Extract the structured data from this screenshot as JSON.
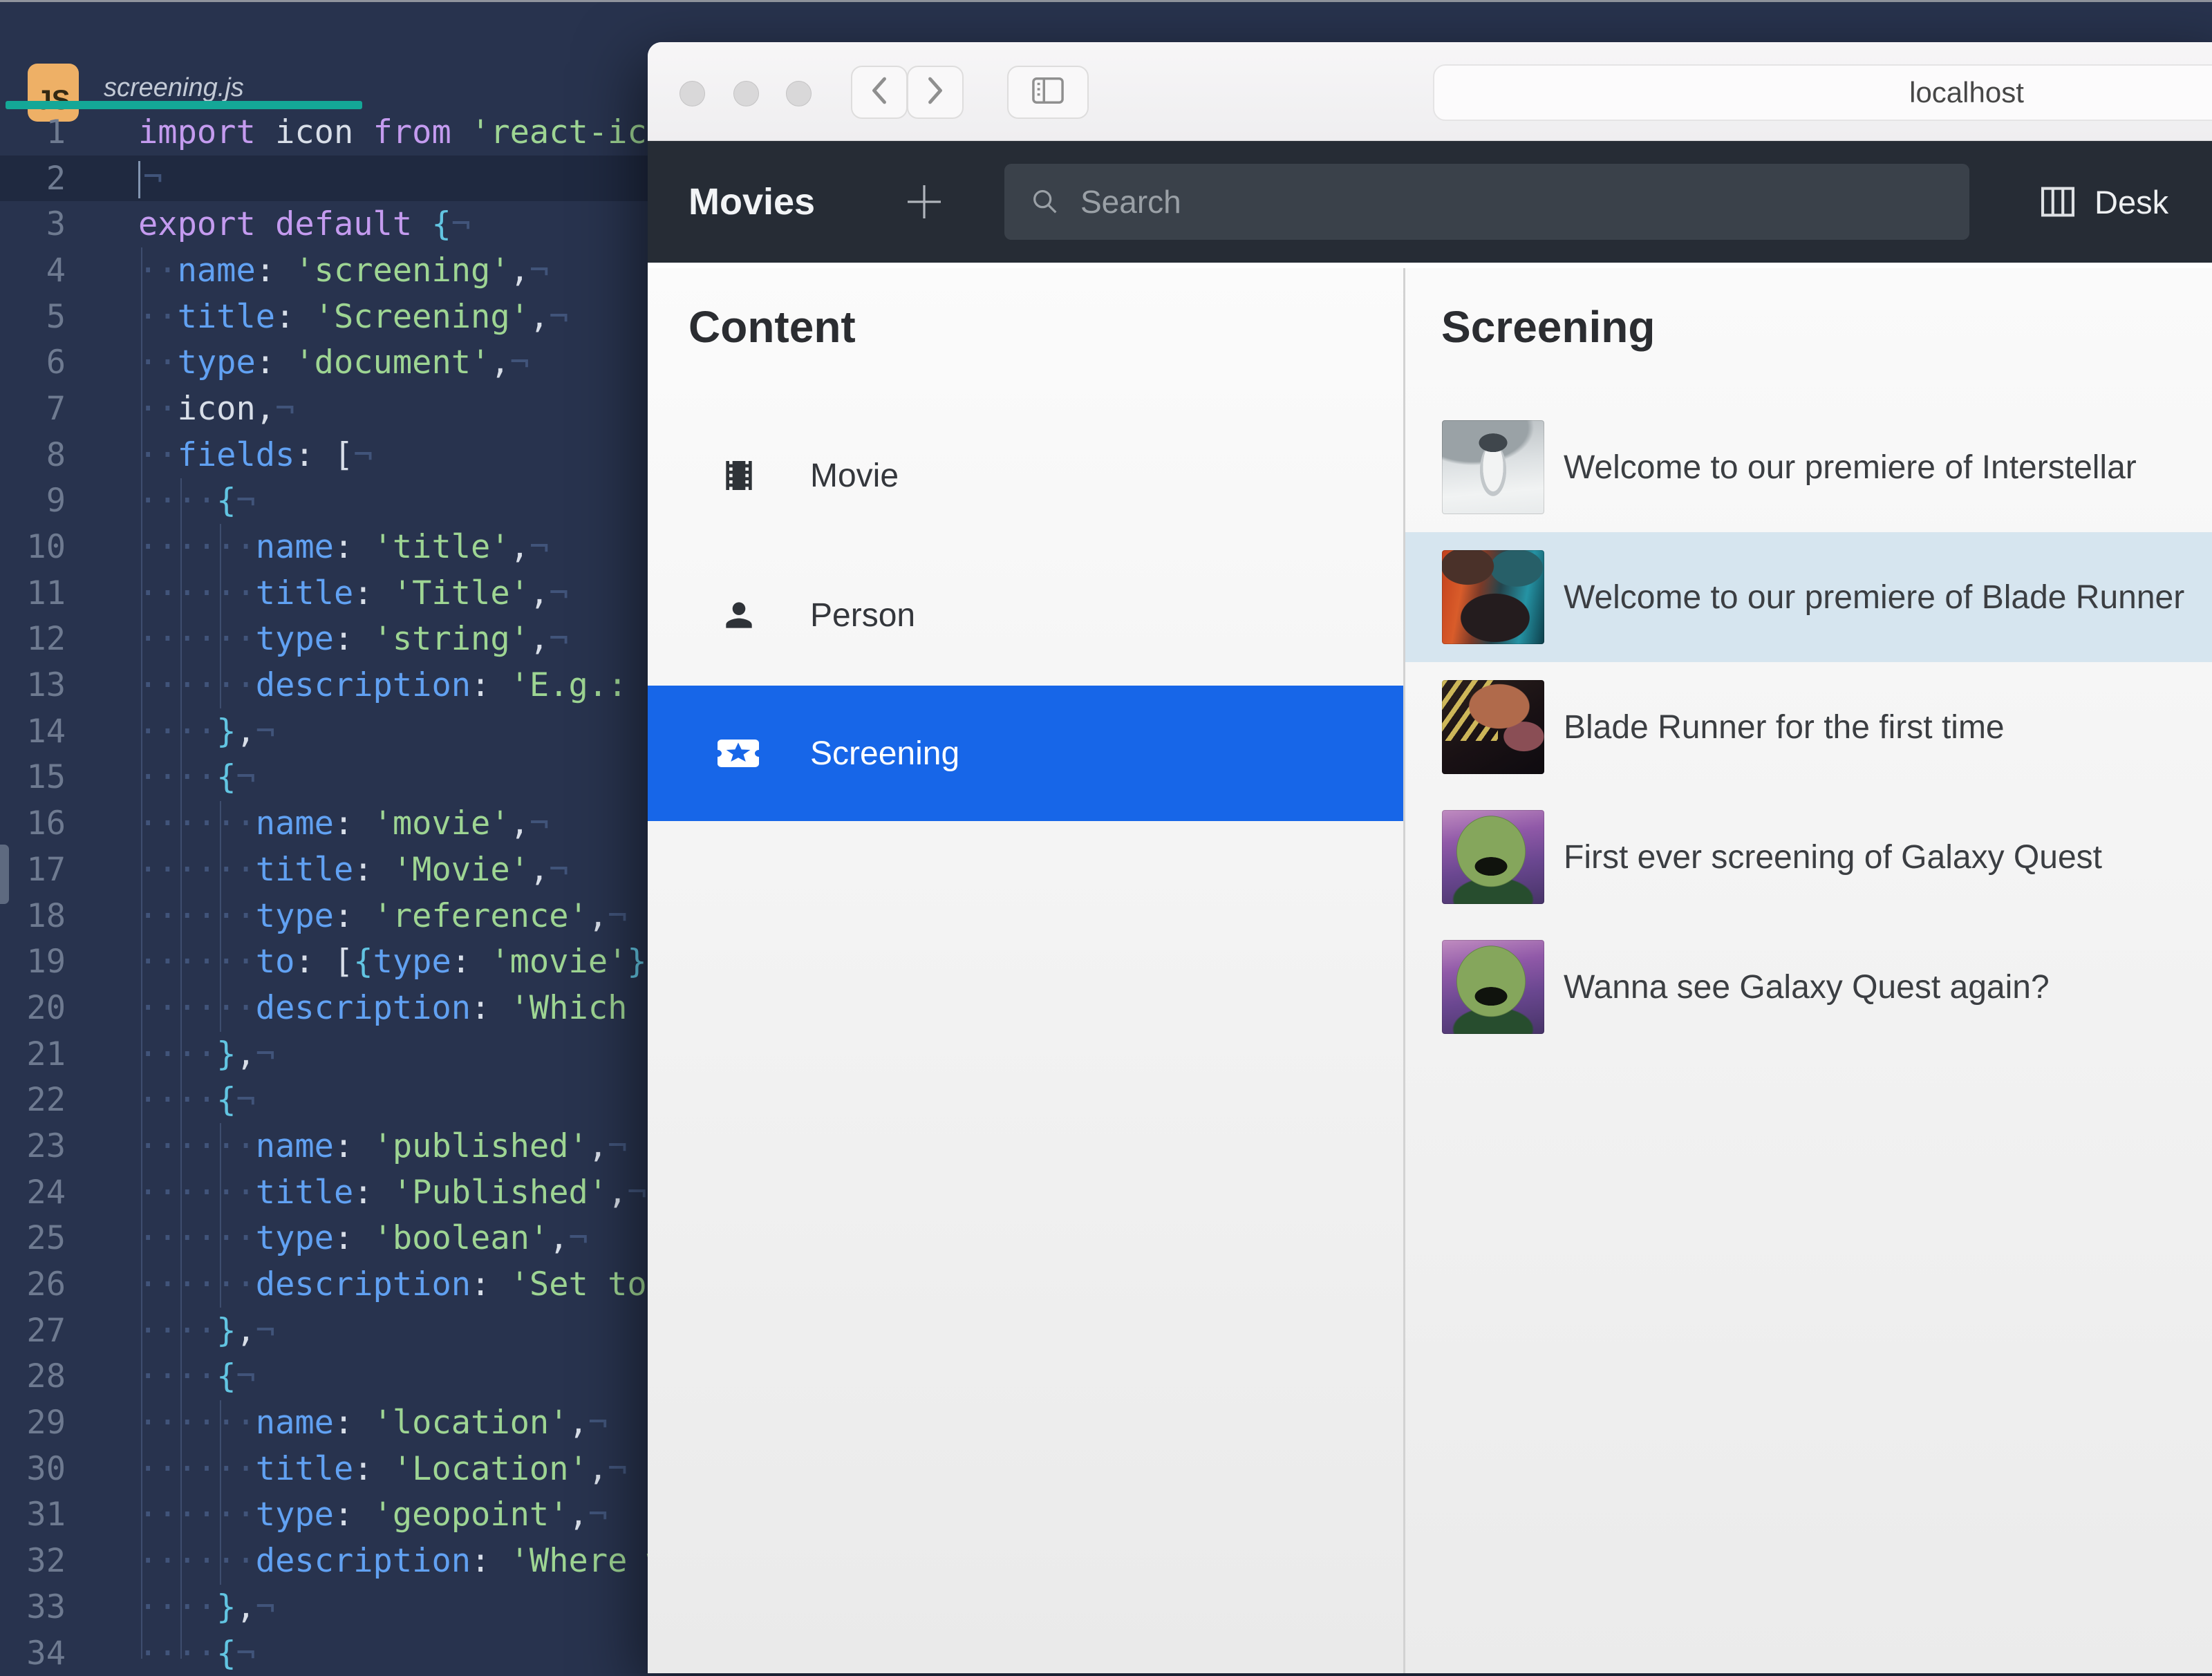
{
  "colors": {
    "accent_blue": "#1766e8",
    "row_highlight": "#d6e5ef",
    "navbar_bg": "#262c35",
    "editor_bg": "#28334e",
    "tab_accent": "#14a797",
    "js_badge": "#eeb066"
  },
  "editor": {
    "tab": {
      "icon_label": "JS",
      "filename": "screening.js"
    },
    "lines": [
      {
        "n": 1,
        "tokens": [
          {
            "t": "import",
            "c": "kw"
          },
          {
            "t": " ",
            "c": "pun"
          },
          {
            "t": "icon",
            "c": "id"
          },
          {
            "t": " ",
            "c": "pun"
          },
          {
            "t": "from",
            "c": "kw"
          },
          {
            "t": " ",
            "c": "pun"
          },
          {
            "t": "'react-ico",
            "c": "str"
          }
        ]
      },
      {
        "n": 2,
        "active": true,
        "caret": true,
        "tokens": [
          {
            "t": "¬",
            "c": "ws"
          }
        ]
      },
      {
        "n": 3,
        "tokens": [
          {
            "t": "export",
            "c": "kw"
          },
          {
            "t": " ",
            "c": "pun"
          },
          {
            "t": "default",
            "c": "kw"
          },
          {
            "t": " ",
            "c": "pun"
          },
          {
            "t": "{",
            "c": "brace"
          },
          {
            "t": "¬",
            "c": "ws"
          }
        ]
      },
      {
        "n": 4,
        "tokens": [
          {
            "t": "··",
            "c": "ws"
          },
          {
            "t": "name",
            "c": "prop"
          },
          {
            "t": ": ",
            "c": "pun"
          },
          {
            "t": "'screening'",
            "c": "str"
          },
          {
            "t": ",",
            "c": "pun"
          },
          {
            "t": "¬",
            "c": "ws"
          }
        ]
      },
      {
        "n": 5,
        "tokens": [
          {
            "t": "··",
            "c": "ws"
          },
          {
            "t": "title",
            "c": "prop"
          },
          {
            "t": ": ",
            "c": "pun"
          },
          {
            "t": "'Screening'",
            "c": "str"
          },
          {
            "t": ",",
            "c": "pun"
          },
          {
            "t": "¬",
            "c": "ws"
          }
        ]
      },
      {
        "n": 6,
        "tokens": [
          {
            "t": "··",
            "c": "ws"
          },
          {
            "t": "type",
            "c": "prop"
          },
          {
            "t": ": ",
            "c": "pun"
          },
          {
            "t": "'document'",
            "c": "str"
          },
          {
            "t": ",",
            "c": "pun"
          },
          {
            "t": "¬",
            "c": "ws"
          }
        ]
      },
      {
        "n": 7,
        "tokens": [
          {
            "t": "··",
            "c": "ws"
          },
          {
            "t": "icon",
            "c": "id"
          },
          {
            "t": ",",
            "c": "pun"
          },
          {
            "t": "¬",
            "c": "ws"
          }
        ]
      },
      {
        "n": 8,
        "tokens": [
          {
            "t": "··",
            "c": "ws"
          },
          {
            "t": "fields",
            "c": "prop"
          },
          {
            "t": ": ",
            "c": "pun"
          },
          {
            "t": "[",
            "c": "pun"
          },
          {
            "t": "¬",
            "c": "ws"
          }
        ]
      },
      {
        "n": 9,
        "tokens": [
          {
            "t": "····",
            "c": "ws"
          },
          {
            "t": "{",
            "c": "brace"
          },
          {
            "t": "¬",
            "c": "ws"
          }
        ]
      },
      {
        "n": 10,
        "tokens": [
          {
            "t": "······",
            "c": "ws"
          },
          {
            "t": "name",
            "c": "prop"
          },
          {
            "t": ": ",
            "c": "pun"
          },
          {
            "t": "'title'",
            "c": "str"
          },
          {
            "t": ",",
            "c": "pun"
          },
          {
            "t": "¬",
            "c": "ws"
          }
        ]
      },
      {
        "n": 11,
        "tokens": [
          {
            "t": "······",
            "c": "ws"
          },
          {
            "t": "title",
            "c": "prop"
          },
          {
            "t": ": ",
            "c": "pun"
          },
          {
            "t": "'Title'",
            "c": "str"
          },
          {
            "t": ",",
            "c": "pun"
          },
          {
            "t": "¬",
            "c": "ws"
          }
        ]
      },
      {
        "n": 12,
        "tokens": [
          {
            "t": "······",
            "c": "ws"
          },
          {
            "t": "type",
            "c": "prop"
          },
          {
            "t": ": ",
            "c": "pun"
          },
          {
            "t": "'string'",
            "c": "str"
          },
          {
            "t": ",",
            "c": "pun"
          },
          {
            "t": "¬",
            "c": "ws"
          }
        ]
      },
      {
        "n": 13,
        "tokens": [
          {
            "t": "······",
            "c": "ws"
          },
          {
            "t": "description",
            "c": "prop"
          },
          {
            "t": ": ",
            "c": "pun"
          },
          {
            "t": "'E.g.: C",
            "c": "str"
          }
        ]
      },
      {
        "n": 14,
        "tokens": [
          {
            "t": "····",
            "c": "ws"
          },
          {
            "t": "}",
            "c": "brace"
          },
          {
            "t": ",",
            "c": "pun"
          },
          {
            "t": "¬",
            "c": "ws"
          }
        ]
      },
      {
        "n": 15,
        "tokens": [
          {
            "t": "····",
            "c": "ws"
          },
          {
            "t": "{",
            "c": "brace"
          },
          {
            "t": "¬",
            "c": "ws"
          }
        ]
      },
      {
        "n": 16,
        "tokens": [
          {
            "t": "······",
            "c": "ws"
          },
          {
            "t": "name",
            "c": "prop"
          },
          {
            "t": ": ",
            "c": "pun"
          },
          {
            "t": "'movie'",
            "c": "str"
          },
          {
            "t": ",",
            "c": "pun"
          },
          {
            "t": "¬",
            "c": "ws"
          }
        ]
      },
      {
        "n": 17,
        "tokens": [
          {
            "t": "······",
            "c": "ws"
          },
          {
            "t": "title",
            "c": "prop"
          },
          {
            "t": ": ",
            "c": "pun"
          },
          {
            "t": "'Movie'",
            "c": "str"
          },
          {
            "t": ",",
            "c": "pun"
          },
          {
            "t": "¬",
            "c": "ws"
          }
        ]
      },
      {
        "n": 18,
        "tokens": [
          {
            "t": "······",
            "c": "ws"
          },
          {
            "t": "type",
            "c": "prop"
          },
          {
            "t": ": ",
            "c": "pun"
          },
          {
            "t": "'reference'",
            "c": "str"
          },
          {
            "t": ",",
            "c": "pun"
          },
          {
            "t": "¬",
            "c": "ws"
          }
        ]
      },
      {
        "n": 19,
        "tokens": [
          {
            "t": "······",
            "c": "ws"
          },
          {
            "t": "to",
            "c": "prop"
          },
          {
            "t": ": ",
            "c": "pun"
          },
          {
            "t": "[",
            "c": "pun"
          },
          {
            "t": "{",
            "c": "brace"
          },
          {
            "t": "type",
            "c": "prop"
          },
          {
            "t": ": ",
            "c": "pun"
          },
          {
            "t": "'movie'",
            "c": "str"
          },
          {
            "t": "}",
            "c": "brace"
          },
          {
            "t": "]",
            "c": "pun"
          }
        ]
      },
      {
        "n": 20,
        "tokens": [
          {
            "t": "······",
            "c": "ws"
          },
          {
            "t": "description",
            "c": "prop"
          },
          {
            "t": ": ",
            "c": "pun"
          },
          {
            "t": "'Which m",
            "c": "str"
          }
        ]
      },
      {
        "n": 21,
        "tokens": [
          {
            "t": "····",
            "c": "ws"
          },
          {
            "t": "}",
            "c": "brace"
          },
          {
            "t": ",",
            "c": "pun"
          },
          {
            "t": "¬",
            "c": "ws"
          }
        ]
      },
      {
        "n": 22,
        "tokens": [
          {
            "t": "····",
            "c": "ws"
          },
          {
            "t": "{",
            "c": "brace"
          },
          {
            "t": "¬",
            "c": "ws"
          }
        ]
      },
      {
        "n": 23,
        "tokens": [
          {
            "t": "······",
            "c": "ws"
          },
          {
            "t": "name",
            "c": "prop"
          },
          {
            "t": ": ",
            "c": "pun"
          },
          {
            "t": "'published'",
            "c": "str"
          },
          {
            "t": ",",
            "c": "pun"
          },
          {
            "t": "¬",
            "c": "ws"
          }
        ]
      },
      {
        "n": 24,
        "tokens": [
          {
            "t": "······",
            "c": "ws"
          },
          {
            "t": "title",
            "c": "prop"
          },
          {
            "t": ": ",
            "c": "pun"
          },
          {
            "t": "'Published'",
            "c": "str"
          },
          {
            "t": ",",
            "c": "pun"
          },
          {
            "t": "¬",
            "c": "ws"
          }
        ]
      },
      {
        "n": 25,
        "tokens": [
          {
            "t": "······",
            "c": "ws"
          },
          {
            "t": "type",
            "c": "prop"
          },
          {
            "t": ": ",
            "c": "pun"
          },
          {
            "t": "'boolean'",
            "c": "str"
          },
          {
            "t": ",",
            "c": "pun"
          },
          {
            "t": "¬",
            "c": "ws"
          }
        ]
      },
      {
        "n": 26,
        "tokens": [
          {
            "t": "······",
            "c": "ws"
          },
          {
            "t": "description",
            "c": "prop"
          },
          {
            "t": ": ",
            "c": "pun"
          },
          {
            "t": "'Set to ",
            "c": "str"
          }
        ]
      },
      {
        "n": 27,
        "tokens": [
          {
            "t": "····",
            "c": "ws"
          },
          {
            "t": "}",
            "c": "brace"
          },
          {
            "t": ",",
            "c": "pun"
          },
          {
            "t": "¬",
            "c": "ws"
          }
        ]
      },
      {
        "n": 28,
        "tokens": [
          {
            "t": "····",
            "c": "ws"
          },
          {
            "t": "{",
            "c": "brace"
          },
          {
            "t": "¬",
            "c": "ws"
          }
        ]
      },
      {
        "n": 29,
        "tokens": [
          {
            "t": "······",
            "c": "ws"
          },
          {
            "t": "name",
            "c": "prop"
          },
          {
            "t": ": ",
            "c": "pun"
          },
          {
            "t": "'location'",
            "c": "str"
          },
          {
            "t": ",",
            "c": "pun"
          },
          {
            "t": "¬",
            "c": "ws"
          }
        ]
      },
      {
        "n": 30,
        "tokens": [
          {
            "t": "······",
            "c": "ws"
          },
          {
            "t": "title",
            "c": "prop"
          },
          {
            "t": ": ",
            "c": "pun"
          },
          {
            "t": "'Location'",
            "c": "str"
          },
          {
            "t": ",",
            "c": "pun"
          },
          {
            "t": "¬",
            "c": "ws"
          }
        ]
      },
      {
        "n": 31,
        "tokens": [
          {
            "t": "······",
            "c": "ws"
          },
          {
            "t": "type",
            "c": "prop"
          },
          {
            "t": ": ",
            "c": "pun"
          },
          {
            "t": "'geopoint'",
            "c": "str"
          },
          {
            "t": ",",
            "c": "pun"
          },
          {
            "t": "¬",
            "c": "ws"
          }
        ]
      },
      {
        "n": 32,
        "tokens": [
          {
            "t": "······",
            "c": "ws"
          },
          {
            "t": "description",
            "c": "prop"
          },
          {
            "t": ": ",
            "c": "pun"
          },
          {
            "t": "'Where w",
            "c": "str"
          }
        ]
      },
      {
        "n": 33,
        "tokens": [
          {
            "t": "····",
            "c": "ws"
          },
          {
            "t": "}",
            "c": "brace"
          },
          {
            "t": ",",
            "c": "pun"
          },
          {
            "t": "¬",
            "c": "ws"
          }
        ]
      },
      {
        "n": 34,
        "tokens": [
          {
            "t": "····",
            "c": "ws"
          },
          {
            "t": "{",
            "c": "brace"
          },
          {
            "t": "¬",
            "c": "ws"
          }
        ]
      }
    ]
  },
  "browser": {
    "titlebar": {
      "url": "localhost"
    },
    "navbar": {
      "title": "Movies",
      "search_placeholder": "Search",
      "desk_label": "Desk"
    },
    "content_pane": {
      "heading": "Content",
      "items": [
        {
          "label": "Movie",
          "icon": "film-icon",
          "selected": false
        },
        {
          "label": "Person",
          "icon": "person-icon",
          "selected": false
        },
        {
          "label": "Screening",
          "icon": "ticket-star-icon",
          "selected": true
        }
      ]
    },
    "list_pane": {
      "heading": "Screening",
      "rows": [
        {
          "text": "Welcome to our premiere of Interstellar",
          "thumb": "interstellar",
          "highlighted": false
        },
        {
          "text": "Welcome to our premiere of Blade Runner",
          "thumb": "br2049",
          "highlighted": true
        },
        {
          "text": "Blade Runner for the first time",
          "thumb": "bladerunner",
          "highlighted": false
        },
        {
          "text": "First ever screening of Galaxy Quest",
          "thumb": "galaxyquest",
          "highlighted": false
        },
        {
          "text": "Wanna see Galaxy Quest again?",
          "thumb": "galaxyquest",
          "highlighted": false
        }
      ]
    }
  }
}
